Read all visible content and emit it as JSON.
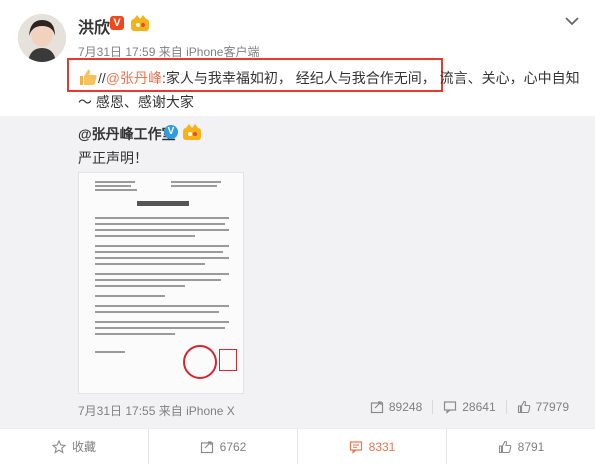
{
  "post": {
    "author": "洪欣",
    "verified_mark": "V",
    "timestamp": "7月31日 17:59",
    "source_prefix": "来自",
    "source": "iPhone客户端",
    "mention": "@张丹峰",
    "text_prefix": "//",
    "text_body": ":家人与我幸福如初， 经纪人与我合作无间， 流言、关心，心中自知～ 感恩、感谢大家",
    "emoji_tail": "",
    "icons": {
      "avatar": "avatar-photo",
      "thumb": "thumbs-up-icon",
      "chevron": "chevron-down-icon"
    }
  },
  "repost": {
    "author": "@张丹峰工作室",
    "verified_mark": "V",
    "text": "严正声明！",
    "image": "document-statement-image",
    "timestamp": "7月31日 17:55",
    "source_prefix": "来自",
    "source": "iPhone X",
    "stats": {
      "reposts": "89248",
      "comments": "28641",
      "likes": "77979"
    }
  },
  "actions": {
    "favorite": "收藏",
    "repost": "6762",
    "comment": "8331",
    "like": "8791"
  },
  "colors": {
    "accent": "#eb7350",
    "highlight_border": "#e8392f",
    "repost_bg": "#f2f2f5",
    "verified_orange": "#f0481b",
    "verified_blue": "#2f9be0"
  }
}
